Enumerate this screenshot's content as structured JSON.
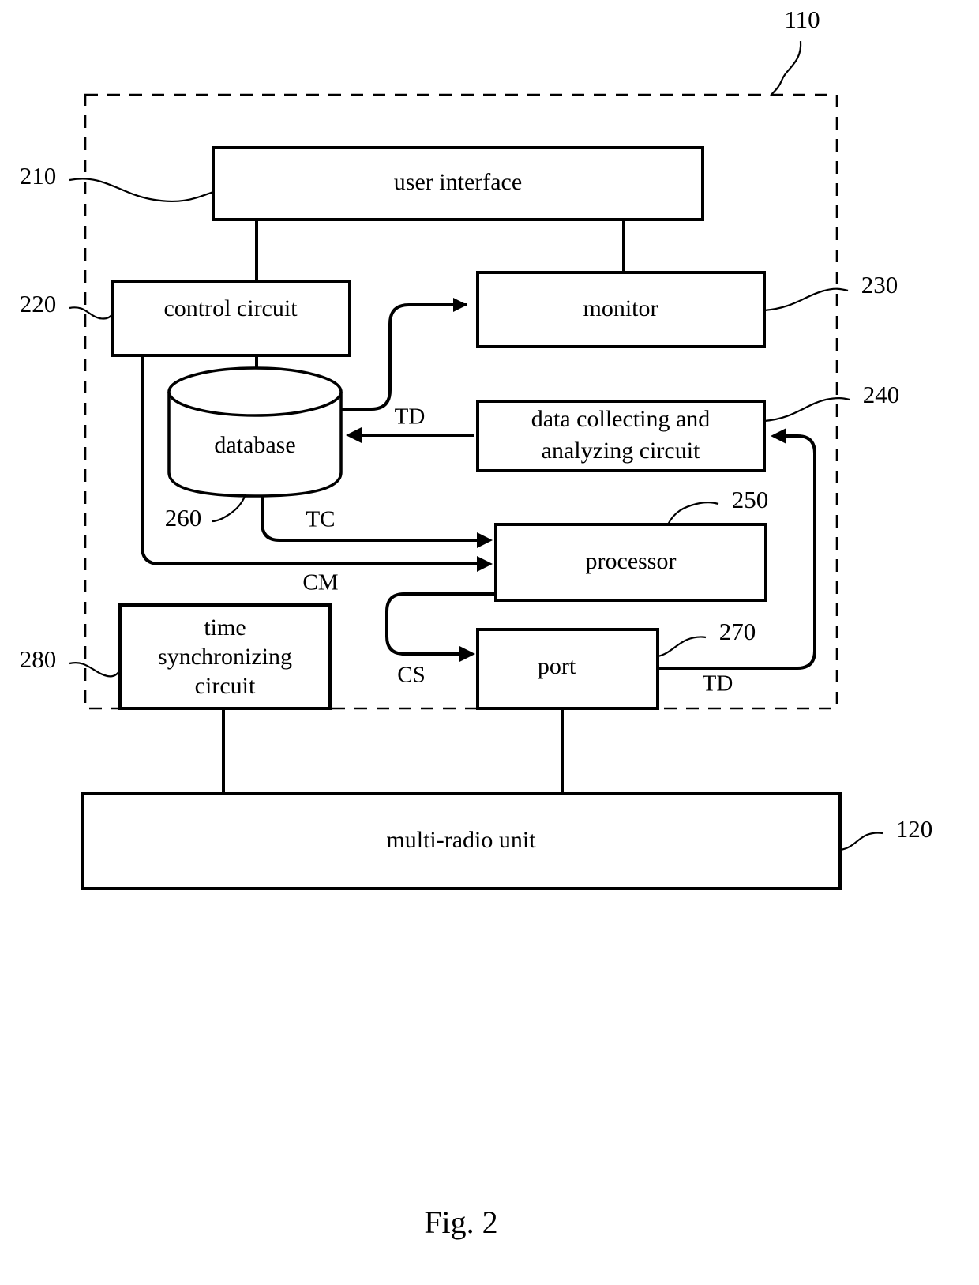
{
  "figure": {
    "caption": "Fig. 2"
  },
  "nodes": {
    "user_interface": {
      "label": "user interface"
    },
    "control_circuit": {
      "label": "control circuit"
    },
    "monitor": {
      "label": "monitor"
    },
    "database": {
      "label": "database"
    },
    "data_collecting": {
      "label_line1": "data collecting and",
      "label_line2": "analyzing circuit"
    },
    "processor": {
      "label": "processor"
    },
    "time_sync": {
      "label_line1": "time",
      "label_line2": "synchronizing",
      "label_line3": "circuit"
    },
    "port": {
      "label": "port"
    },
    "multi_radio": {
      "label": "multi-radio unit"
    }
  },
  "reference_numerals": {
    "system_boundary": "110",
    "user_interface": "210",
    "control_circuit": "220",
    "monitor": "230",
    "data_collecting": "240",
    "processor": "250",
    "database": "260",
    "port": "270",
    "time_sync": "280",
    "multi_radio": "120"
  },
  "signal_labels": {
    "td_database": "TD",
    "tc": "TC",
    "cm": "CM",
    "cs": "CS",
    "td_port": "TD"
  },
  "colors": {
    "stroke": "#000000",
    "fill": "#ffffff"
  }
}
